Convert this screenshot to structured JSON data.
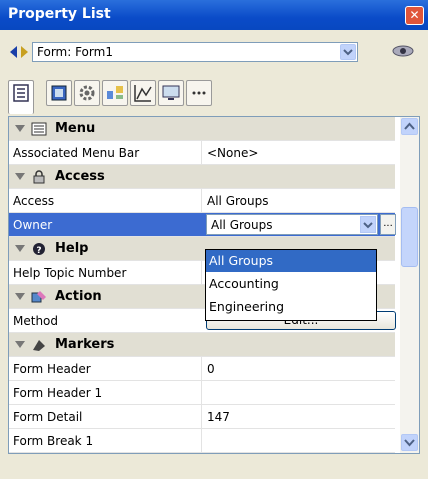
{
  "window": {
    "title": "Property List",
    "close_glyph": "✕"
  },
  "form_selector": {
    "value": "Form: Form1"
  },
  "tabs": [
    "properties-tab",
    "form-tab",
    "gear-tab",
    "objects-tab",
    "chart-tab",
    "preview-tab",
    "more-tab"
  ],
  "grid": {
    "rows": [
      {
        "type": "section",
        "label": "Menu",
        "icon": "menu-icon"
      },
      {
        "type": "prop",
        "key": "Associated Menu Bar",
        "value": "<None>"
      },
      {
        "type": "section",
        "label": "Access",
        "icon": "lock-icon"
      },
      {
        "type": "prop",
        "key": "Access",
        "value": "All Groups"
      },
      {
        "type": "prop-selected",
        "key": "Owner",
        "value": "All Groups"
      },
      {
        "type": "section",
        "label": "Help",
        "icon": "help-icon"
      },
      {
        "type": "prop",
        "key": "Help Topic Number",
        "value": ""
      },
      {
        "type": "section",
        "label": "Action",
        "icon": "action-icon"
      },
      {
        "type": "prop-button",
        "key": "Method",
        "value": "Edit..."
      },
      {
        "type": "section",
        "label": "Markers",
        "icon": "markers-icon"
      },
      {
        "type": "prop",
        "key": "Form Header",
        "value": "0"
      },
      {
        "type": "prop",
        "key": "Form Header 1",
        "value": ""
      },
      {
        "type": "prop",
        "key": "Form Detail",
        "value": "147"
      },
      {
        "type": "prop",
        "key": "Form Break 1",
        "value": ""
      }
    ]
  },
  "owner_dropdown": {
    "options": [
      "All Groups",
      "Accounting",
      "Engineering"
    ],
    "highlighted": 0
  },
  "ellipsis_label": "...",
  "colors": {
    "title_bar": "#0a4bc8",
    "selection": "#316ac5",
    "section_bg": "#e1dfd3"
  }
}
